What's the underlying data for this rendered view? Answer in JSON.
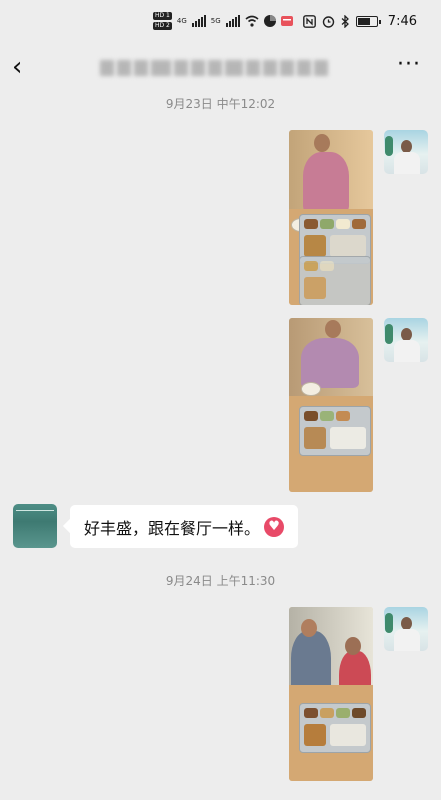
{
  "status_bar": {
    "time": "7:46",
    "hd_badges": [
      "HD 1",
      "HD 2"
    ],
    "network_labels": [
      "4G",
      "5G"
    ],
    "icons": [
      "signal-icon",
      "wifi-icon",
      "nfc-icon",
      "alarm-icon",
      "bluetooth-icon",
      "battery-icon"
    ]
  },
  "header": {
    "back_icon": "back-icon",
    "back_glyph": "‹",
    "more_icon": "more-icon",
    "more_glyph": "···"
  },
  "messages": [
    {
      "type": "timestamp",
      "text": "9月23日 中午12:02"
    },
    {
      "type": "image",
      "sender": "me",
      "content": "photo-elderly-woman-with-meal-tray"
    },
    {
      "type": "image",
      "sender": "me",
      "content": "photo-elderly-woman-eating-meal"
    },
    {
      "type": "text",
      "sender": "other",
      "text": "好丰盛，跟在餐厅一样。",
      "emoji": "heart-emoji"
    },
    {
      "type": "timestamp",
      "text": "9月24日 上午11:30"
    },
    {
      "type": "image",
      "sender": "me",
      "content": "photo-caregiver-feeding-elderly-woman"
    }
  ]
}
